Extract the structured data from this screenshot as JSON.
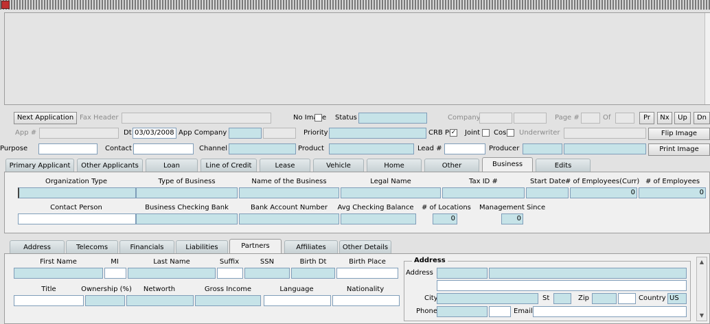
{
  "form": {
    "next_application": "Next Application",
    "fax_header": "Fax Header",
    "no_image": "No Image",
    "status": "Status",
    "company": "Company",
    "page_num": "Page #",
    "of": "Of",
    "pr": "Pr",
    "nx": "Nx",
    "up": "Up",
    "dn": "Dn",
    "app_num": "App #",
    "dt": "Dt",
    "dt_value": "03/03/2008",
    "app_company": "App Company",
    "priority": "Priority",
    "crb_pull": "CRB Pull",
    "joint": "Joint",
    "cos": "Cos",
    "underwriter": "Underwriter",
    "flip_image": "Flip Image",
    "purpose": "Purpose",
    "contact": "Contact",
    "channel": "Channel",
    "product": "Product",
    "lead_num": "Lead #",
    "producer": "Producer",
    "print_image": "Print Image",
    "check_mark": "✓"
  },
  "main_tabs": [
    "Primary Applicant",
    "Other Applicants",
    "Loan",
    "Line of Credit",
    "Lease",
    "Vehicle",
    "Home",
    "Other",
    "Business",
    "Edits"
  ],
  "business": {
    "org_type": "Organization Type",
    "type_of_business": "Type of Business",
    "name_of_business": "Name of the Business",
    "legal_name": "Legal Name",
    "tax_id": "Tax ID #",
    "start_date": "Start Date",
    "num_emp_curr": "# of Employees(Curr)",
    "num_emp": "# of Employees",
    "num_emp_curr_value": "0",
    "num_emp_value": "0",
    "contact_person": "Contact Person",
    "checking_bank": "Business Checking Bank",
    "bank_account": "Bank Account Number",
    "avg_balance": "Avg Checking Balance",
    "num_locations": "# of Locations",
    "mgmt_since": "Management Since",
    "num_locations_value": "0",
    "mgmt_since_value": "0"
  },
  "sub_tabs": [
    "Address",
    "Telecoms",
    "Financials",
    "Liabilities",
    "Partners",
    "Affiliates",
    "Other Details"
  ],
  "partners": {
    "first_name": "First Name",
    "mi": "MI",
    "last_name": "Last Name",
    "suffix": "Suffix",
    "ssn": "SSN",
    "birth_dt": "Birth Dt",
    "birth_place": "Birth Place",
    "title": "Title",
    "ownership": "Ownership (%)",
    "networth": "Networth",
    "gross_income": "Gross Income",
    "language": "Language",
    "nationality": "Nationality"
  },
  "address": {
    "section": "Address",
    "address": "Address",
    "city": "City",
    "st": "St",
    "zip": "Zip",
    "country": "Country",
    "country_value": "US",
    "phone": "Phone",
    "email": "Email"
  }
}
